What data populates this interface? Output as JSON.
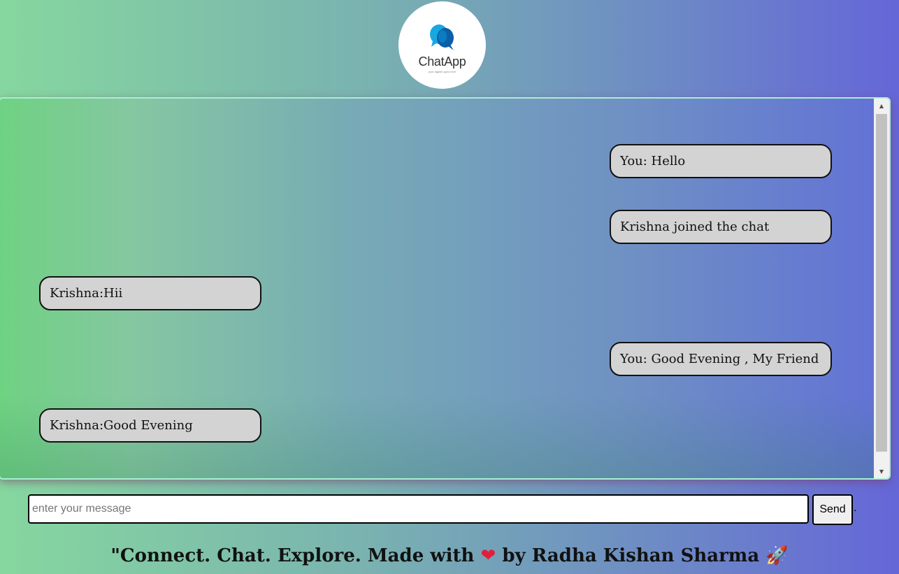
{
  "logo": {
    "title": "ChatApp",
    "tagline": "your tagline goes here",
    "icon": "chat-bubbles-icon"
  },
  "messages": [
    {
      "side": "right",
      "text": "You: Hello"
    },
    {
      "side": "right",
      "text": "Krishna joined the chat"
    },
    {
      "side": "left",
      "text": "Krishna:Hii"
    },
    {
      "side": "right",
      "text": "You: Good Evening , My Friend"
    },
    {
      "side": "left",
      "text": "Krishna:Good Evening"
    }
  ],
  "composer": {
    "placeholder": "enter your message",
    "value": "",
    "send_label": "Send",
    "trailing": "."
  },
  "footer": {
    "text_before": "\"Connect. Chat. Explore. Made with",
    "heart": "❤",
    "text_after": "by Radha Kishan Sharma",
    "rocket": "🚀"
  },
  "colors": {
    "bubble_bg": "#d3d3d3",
    "panel_border": "#a8f0d4",
    "gradient_start": "#86d79f",
    "gradient_end": "#6566d8"
  }
}
